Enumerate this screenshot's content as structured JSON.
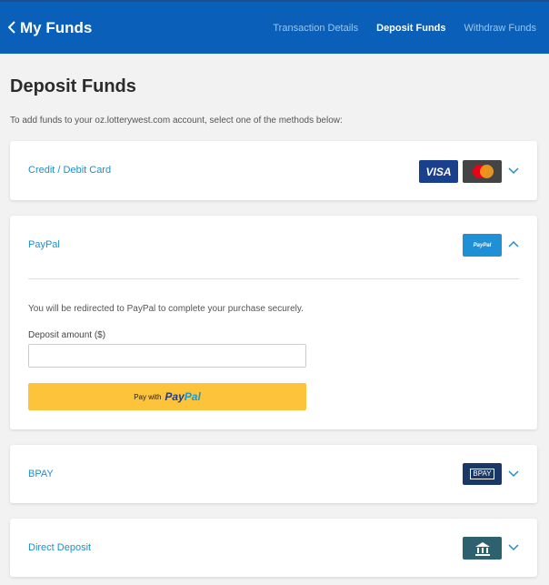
{
  "header": {
    "back_title": "My Funds",
    "nav": [
      "Transaction Details",
      "Deposit Funds",
      "Withdraw Funds"
    ],
    "active_nav": "Deposit Funds",
    "color": "#0a5fb8"
  },
  "page": {
    "title": "Deposit Funds",
    "intro": "To add funds to your oz.lotterywest.com account, select one of the methods below:"
  },
  "methods": {
    "card": {
      "label": "Credit / Debit Card",
      "visa_text": "VISA",
      "expanded": false
    },
    "paypal": {
      "label": "PayPal",
      "badge_text": "PayPal",
      "expanded": true,
      "redirect_text": "You will be redirected to PayPal to complete your purchase securely.",
      "amount_label": "Deposit amount ($)",
      "amount_value": "",
      "button_prefix": "Pay with",
      "button_brand_1": "Pay",
      "button_brand_2": "Pal"
    },
    "bpay": {
      "label": "BPAY",
      "badge_text": "BPAY",
      "expanded": false
    },
    "direct": {
      "label": "Direct Deposit",
      "expanded": false
    }
  },
  "icons": {
    "back": "chevron-left-icon",
    "expand": "chevron-down-icon",
    "collapse": "chevron-up-icon",
    "bank": "bank-icon"
  }
}
